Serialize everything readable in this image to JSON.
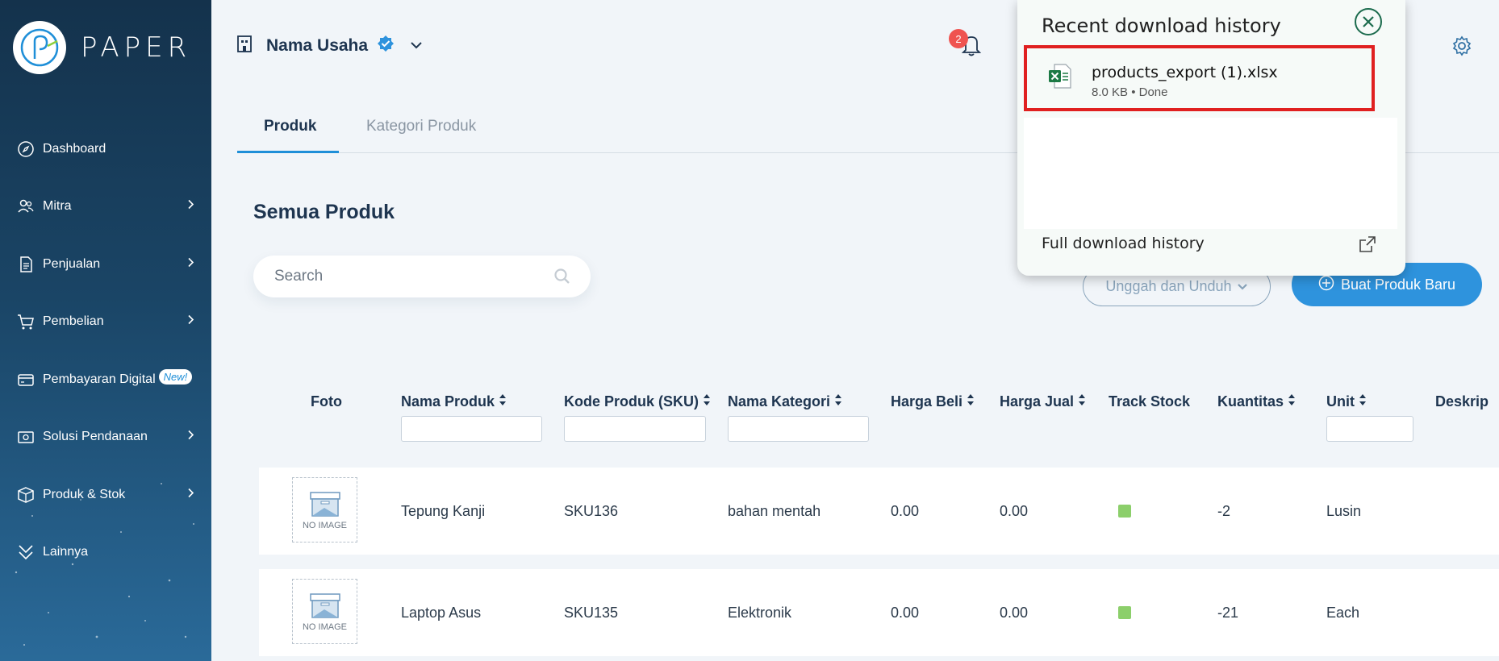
{
  "brand": {
    "name": "PAPER"
  },
  "sidebar": {
    "items": [
      {
        "label": "Dashboard",
        "icon": "compass-icon"
      },
      {
        "label": "Mitra",
        "icon": "users-icon"
      },
      {
        "label": "Penjualan",
        "icon": "document-icon"
      },
      {
        "label": "Pembelian",
        "icon": "cart-icon"
      },
      {
        "label": "Pembayaran Digital",
        "icon": "card-icon",
        "badge": "New!"
      },
      {
        "label": "Solusi Pendanaan",
        "icon": "cash-icon"
      },
      {
        "label": "Produk & Stok",
        "icon": "box-icon"
      },
      {
        "label": "Lainnya",
        "icon": "chevrons-down-icon"
      }
    ]
  },
  "header": {
    "business_name": "Nama Usaha",
    "notification_count": "2"
  },
  "tabs": [
    {
      "label": "Produk"
    },
    {
      "label": "Kategori Produk"
    }
  ],
  "main": {
    "title": "Semua Produk",
    "search_placeholder": "Search",
    "upload_download_label": "Unggah dan Unduh",
    "create_button_label": "Buat Produk Baru"
  },
  "table": {
    "columns": [
      "Foto",
      "Nama Produk",
      "Kode Produk (SKU)",
      "Nama Kategori",
      "Harga Beli",
      "Harga Jual",
      "Track Stock",
      "Kuantitas",
      "Unit",
      "Deskrip"
    ],
    "no_image_label": "NO IMAGE",
    "rows": [
      {
        "name": "Tepung Kanji",
        "sku": "SKU136",
        "category": "bahan mentah",
        "buy_price": "0.00",
        "sell_price": "0.00",
        "quantity": "-2",
        "unit": "Lusin"
      },
      {
        "name": "Laptop Asus",
        "sku": "SKU135",
        "category": "Elektronik",
        "buy_price": "0.00",
        "sell_price": "0.00",
        "quantity": "-21",
        "unit": "Each"
      }
    ]
  },
  "download_popup": {
    "title": "Recent download history",
    "item": {
      "file_name": "products_export (1).xlsx",
      "meta": "8.0 KB • Done"
    },
    "footer": "Full download history"
  },
  "colors": {
    "accent": "#2e93dd",
    "sidebar_top": "#14324c",
    "highlight": "#e02020"
  }
}
